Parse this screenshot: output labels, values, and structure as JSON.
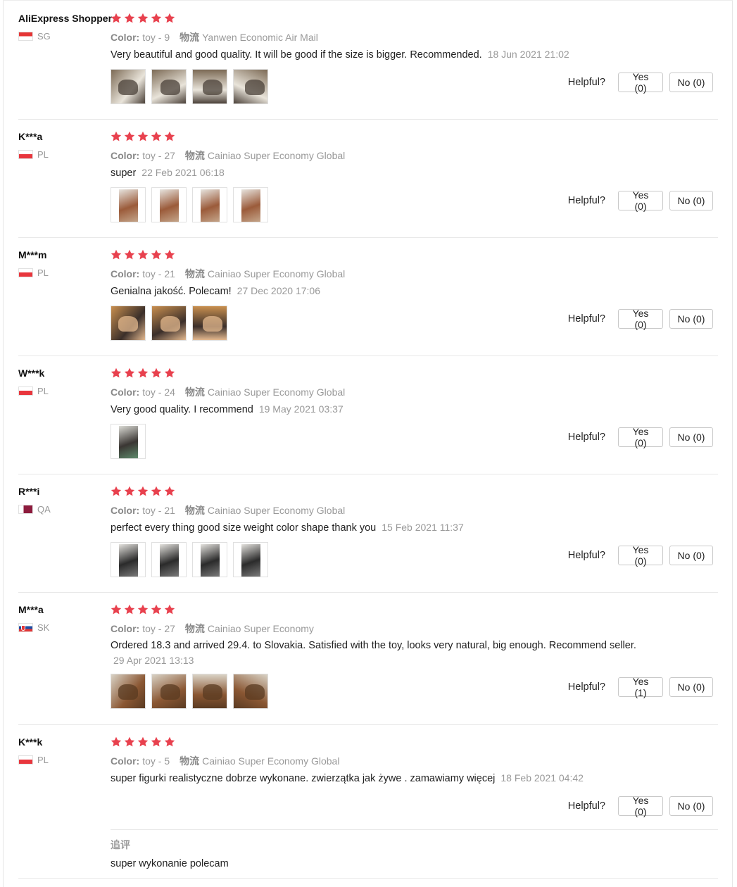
{
  "colors": {
    "star": "#e8414e",
    "muted_text": "#999999",
    "divider": "#e8e8e8"
  },
  "helpful_label": "Helpful?",
  "reviews": [
    {
      "user": "AliExpress Shopper",
      "country": "SG",
      "flag": "sg",
      "rating": 5,
      "color_label": "Color:",
      "color_value": "toy - 9",
      "shipping_label": "物流",
      "shipping_value": "Yanwen Economic Air Mail",
      "text": "Very beautiful and good quality. It will be good if the size is bigger. Recommended.",
      "date": "18 Jun 2021 21:02",
      "photos": [
        "polar bear figurine photo",
        "polar bear figurine photo",
        "polar bear figurine photo",
        "polar bear figurine photo"
      ],
      "yes": "Yes (0)",
      "no": "No (0)"
    },
    {
      "user": "K***a",
      "country": "PL",
      "flag": "pl",
      "rating": 5,
      "color_label": "Color:",
      "color_value": "toy - 27",
      "shipping_label": "物流",
      "shipping_value": "Cainiao Super Economy Global",
      "text": "super",
      "date": "22 Feb 2021 06:18",
      "photos": [
        "animal figurine photo",
        "animal figurine photo",
        "animal figurine photo",
        "animal figurine photo"
      ],
      "yes": "Yes (0)",
      "no": "No (0)"
    },
    {
      "user": "M***m",
      "country": "PL",
      "flag": "pl",
      "rating": 5,
      "color_label": "Color:",
      "color_value": "toy - 21",
      "shipping_label": "物流",
      "shipping_value": "Cainiao Super Economy Global",
      "text": "Genialna jakość. Polecam!",
      "date": "27 Dec 2020 17:06",
      "photos": [
        "animal figurine photo",
        "animal figurine photo",
        "animal figurine photo"
      ],
      "yes": "Yes (0)",
      "no": "No (0)"
    },
    {
      "user": "W***k",
      "country": "PL",
      "flag": "pl",
      "rating": 5,
      "color_label": "Color:",
      "color_value": "toy - 24",
      "shipping_label": "物流",
      "shipping_value": "Cainiao Super Economy Global",
      "text": "Very good quality. I recommend",
      "date": "19 May 2021 03:37",
      "photos": [
        "animal figurine photo"
      ],
      "yes": "Yes (0)",
      "no": "No (0)"
    },
    {
      "user": "R***i",
      "country": "QA",
      "flag": "qa",
      "rating": 5,
      "color_label": "Color:",
      "color_value": "toy - 21",
      "shipping_label": "物流",
      "shipping_value": "Cainiao Super Economy Global",
      "text": "perfect every thing good size weight color shape thank you",
      "date": "15 Feb 2021 11:37",
      "photos": [
        "animal figurine photo",
        "animal figurine photo",
        "animal figurine photo",
        "animal figurine photo"
      ],
      "yes": "Yes (0)",
      "no": "No (0)"
    },
    {
      "user": "M***a",
      "country": "SK",
      "flag": "sk",
      "rating": 5,
      "color_label": "Color:",
      "color_value": "toy - 27",
      "shipping_label": "物流",
      "shipping_value": "Cainiao Super Economy",
      "text": "Ordered 18.3 and arrived 29.4. to Slovakia. Satisfied with the toy, looks very natural, big enough. Recommend seller.",
      "date": "29 Apr 2021 13:13",
      "photos": [
        "camel figurine photo",
        "camel figurine photo",
        "camel figurine photo",
        "camel figurine photo"
      ],
      "yes": "Yes (1)",
      "no": "No (0)"
    },
    {
      "user": "K***k",
      "country": "PL",
      "flag": "pl",
      "rating": 5,
      "color_label": "Color:",
      "color_value": "toy - 5",
      "shipping_label": "物流",
      "shipping_value": "Cainiao Super Economy Global",
      "text": "super figurki realistyczne dobrze wykonane. zwierzątka jak żywe . zamawiamy więcej",
      "date": "18 Feb 2021 04:42",
      "photos": [],
      "yes": "Yes (0)",
      "no": "No (0)"
    }
  ],
  "followup": {
    "title": "追评",
    "text": "super wykonanie polecam"
  }
}
